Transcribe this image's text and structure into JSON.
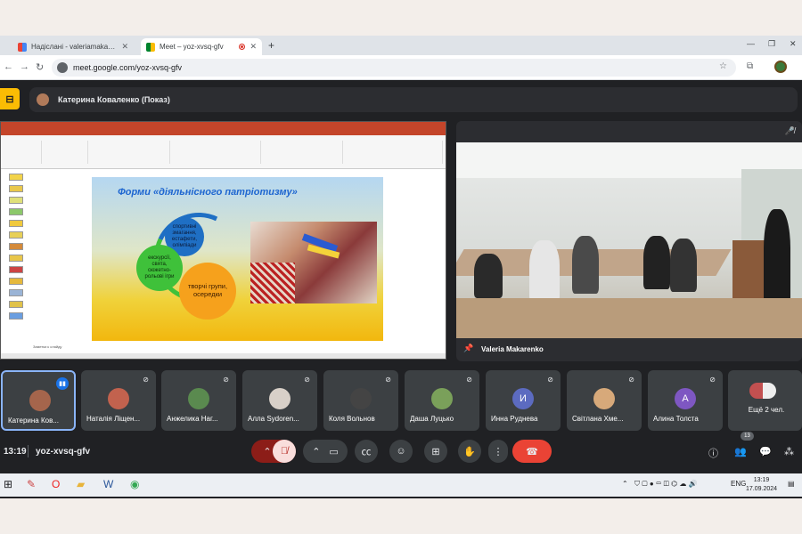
{
  "browser": {
    "tabs": [
      {
        "label": "Надіслані - valeriamakarenko0",
        "icon": "gmail-icon"
      },
      {
        "label": "Meet – yoz-xvsq-gfv",
        "icon": "meet-icon",
        "recording": true
      }
    ],
    "url": "meet.google.com/yoz-xvsq-gfv"
  },
  "meet": {
    "presenter_chip": "Катерина Коваленко (Показ)",
    "pinned_name": "Valeria Makarenko",
    "time": "13:19",
    "code": "yoz-xvsq-gfv",
    "people_count": "13"
  },
  "slide": {
    "title": "Форми «діяльнісного патріотизму»",
    "gears": [
      "спортивні змагання, естафети, олімпіади",
      "екскурсії, свята, сюжетно-рольові ігри",
      "творчі групи, осередки"
    ],
    "notes_label": "Заметки к слайду"
  },
  "participants": [
    {
      "name": "Катерина Ков...",
      "initial": "",
      "color": "#a5654c",
      "speaking": true
    },
    {
      "name": "Наталія Ліщен...",
      "initial": "",
      "color": "#c2624e"
    },
    {
      "name": "Анжелика Наг...",
      "initial": "",
      "color": "#5a8a4f"
    },
    {
      "name": "Алла Sydoren...",
      "initial": "",
      "color": "#d8d0c8"
    },
    {
      "name": "Коля Вольнов",
      "initial": "",
      "color": "#444"
    },
    {
      "name": "Даша Луцько",
      "initial": "",
      "color": "#7aa05a"
    },
    {
      "name": "Инна Руднева",
      "initial": "И",
      "color": "#5c6bc0"
    },
    {
      "name": "Світлана Хме...",
      "initial": "",
      "color": "#d7a97a"
    },
    {
      "name": "Алина Толста",
      "initial": "А",
      "color": "#7e57c2"
    },
    {
      "name": "Ещё 2 чел.",
      "initial": "",
      "color": "#c25050"
    }
  ],
  "taskbar": {
    "lang": "ENG",
    "time": "13:19",
    "date": "17.09.2024"
  }
}
